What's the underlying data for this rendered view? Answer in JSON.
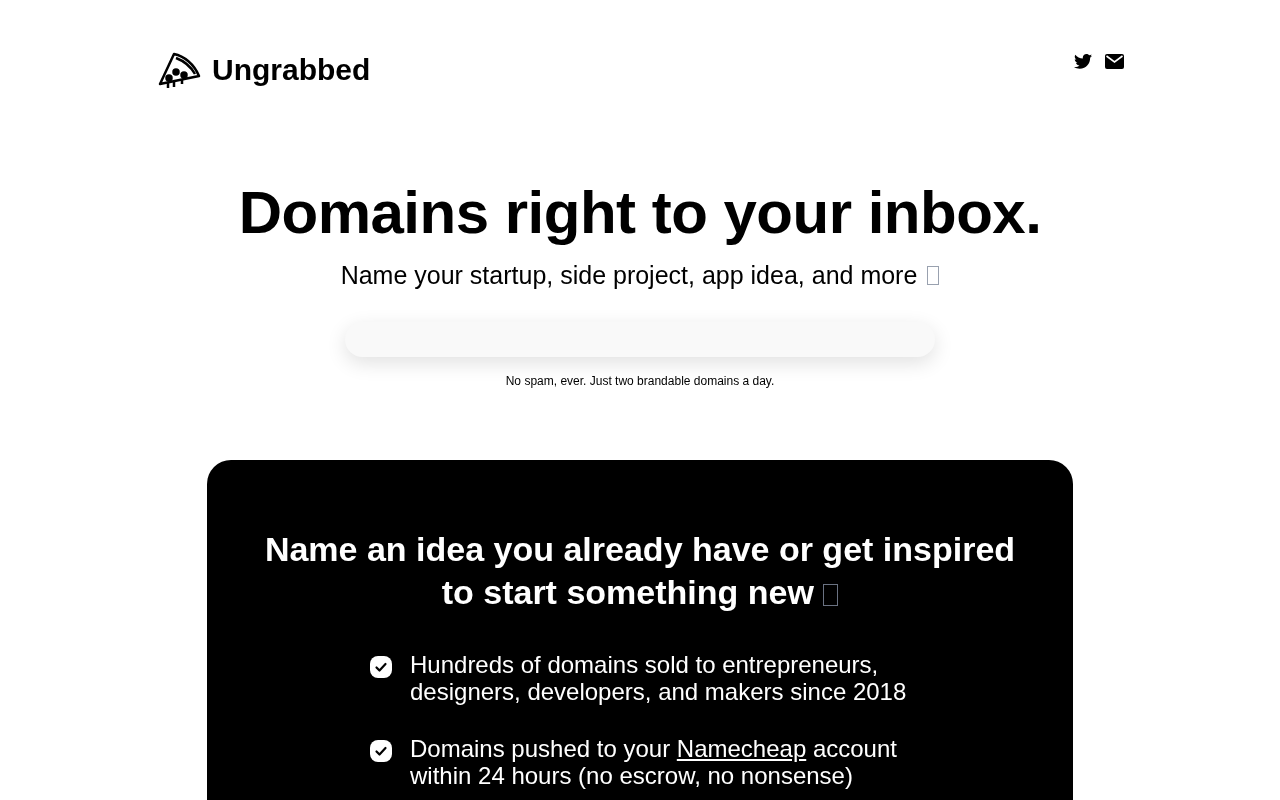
{
  "brand": {
    "name": "Ungrabbed"
  },
  "hero": {
    "title": "Domains right to your inbox.",
    "subtitle": "Name your startup, side project, app idea, and more",
    "note": "No spam, ever. Just two brandable domains a day."
  },
  "card": {
    "title": "Name an idea you already have or get inspired to start something new",
    "items": [
      {
        "text_before": "Hundreds of domains sold to entrepreneurs, designers, developers, and makers since 2018"
      },
      {
        "text_before": "Domains pushed to your ",
        "link": "Namecheap",
        "text_after": " account within 24 hours (no escrow, no nonsense)"
      }
    ]
  }
}
